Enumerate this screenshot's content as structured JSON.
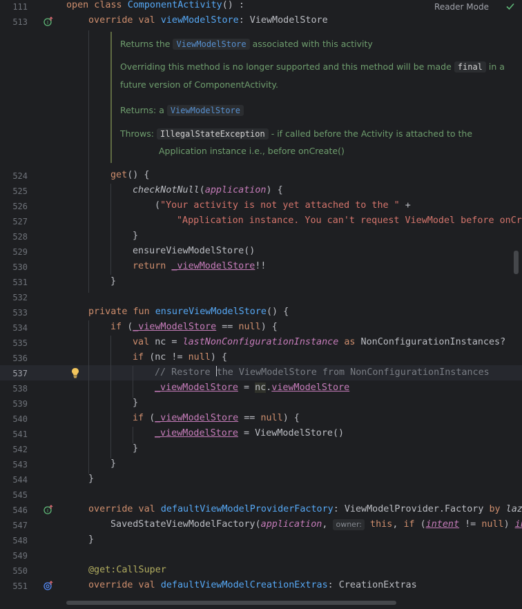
{
  "toolbar": {
    "reader_mode_label": "Reader Mode"
  },
  "gutter": {
    "line_111": "111",
    "line_513": "513",
    "line_524": "524",
    "line_525": "525",
    "line_526": "526",
    "line_527": "527",
    "line_528": "528",
    "line_529": "529",
    "line_530": "530",
    "line_531": "531",
    "line_532": "532",
    "line_533": "533",
    "line_534": "534",
    "line_535": "535",
    "line_536": "536",
    "line_537": "537",
    "line_538": "538",
    "line_539": "539",
    "line_540": "540",
    "line_541": "541",
    "line_542": "542",
    "line_543": "543",
    "line_544": "544",
    "line_545": "545",
    "line_546": "546",
    "line_547": "547",
    "line_548": "548",
    "line_549": "549",
    "line_550": "550",
    "line_551": "551"
  },
  "doc": {
    "returns_prefix": "Returns the",
    "returns_code": "ViewModelStore",
    "returns_suffix": "associated with this activity",
    "overriding_prefix": "Overriding this method is no longer supported and this method will be made",
    "overriding_code": "final",
    "overriding_suffix": "in a",
    "overriding_line2": "future version of ComponentActivity.",
    "returns_label": "Returns:",
    "returns_a": "a",
    "returns_type": "ViewModelStore",
    "throws_label": "Throws:",
    "throws_type": "IllegalStateException",
    "throws_desc": "- if called before the Activity is attached to the",
    "throws_desc2": "Application instance i.e., before onCreate()"
  },
  "code": {
    "l111_kw": "open class ",
    "l111_name": "ComponentActivity",
    "l111_rest": "() :",
    "l513_kw": "override val ",
    "l513_name": "viewModelStore",
    "l513_rest": ": ViewModelStore",
    "l524_get": "get",
    "l524_rest": "() {",
    "l525_fn": "checkNotNull",
    "l525_p": "(",
    "l525_arg": "application",
    "l525_rest": ") {",
    "l526_p": "(",
    "l526_str": "\"Your activity is not yet attached to the \"",
    "l526_plus": " +",
    "l527_str": "\"Application instance. You can't request ViewModel before onCr",
    "l528": "}",
    "l529": "ensureViewModelStore()",
    "l530_kw": "return ",
    "l530_fld": "_viewModelStore",
    "l530_rest": "!!",
    "l531": "}",
    "l533_kw": "private fun ",
    "l533_name": "ensureViewModelStore",
    "l533_rest": "() {",
    "l534_kw": "if ",
    "l534_p": "(",
    "l534_fld": "_viewModelStore",
    "l534_op": " == ",
    "l534_null": "null",
    "l534_rest": ") {",
    "l535_kw": "val ",
    "l535_var": "nc",
    "l535_eq": " = ",
    "l535_prop": "lastNonConfigurationInstance",
    "l535_as": " as ",
    "l535_type": "NonConfigurationInstances?",
    "l536_kw": "if ",
    "l536_p": "(nc != ",
    "l536_null": "null",
    "l536_rest": ") {",
    "l537_cmt_a": "// Restore ",
    "l537_cmt_b": "the ViewModelStore from NonConfigurationInstances",
    "l538_fld": "_viewModelStore",
    "l538_eq": " = ",
    "l538_nc": "nc",
    "l538_dot": ".",
    "l538_fld2": "viewModelStore",
    "l539": "}",
    "l540_kw": "if ",
    "l540_p": "(",
    "l540_fld": "_viewModelStore",
    "l540_op": " == ",
    "l540_null": "null",
    "l540_rest": ") {",
    "l541_fld": "_viewModelStore",
    "l541_rest": " = ViewModelStore()",
    "l542": "}",
    "l543": "}",
    "l544": "}",
    "l546_kw": "override val ",
    "l546_name": "defaultViewModelProviderFactory",
    "l546_rest": ": ViewModelProvider.",
    "l546_factory": "Factory",
    "l546_by": " by ",
    "l546_laz": "laz",
    "l547_fn": "SavedStateViewModelFactory(",
    "l547_arg": "application",
    "l547_comma": ", ",
    "l547_hint": "owner:",
    "l547_this": " this",
    "l547_c2": ", ",
    "l547_if": "if ",
    "l547_p": "(",
    "l547_intent": "intent",
    "l547_op": " != ",
    "l547_null": "null",
    "l547_rest": ") ",
    "l547_in": "in",
    "l548": "}",
    "l550_ann": "@get:",
    "l550_name": "CallSuper",
    "l551_kw": "override val ",
    "l551_name": "defaultViewModelCreationExtras",
    "l551_rest": ": CreationExtras"
  },
  "colors": {
    "background": "#1e1f22",
    "keyword": "#cf8e6d",
    "function": "#56a8f5",
    "string": "#6aab73",
    "field": "#c77dbb",
    "comment": "#7a7e85"
  }
}
